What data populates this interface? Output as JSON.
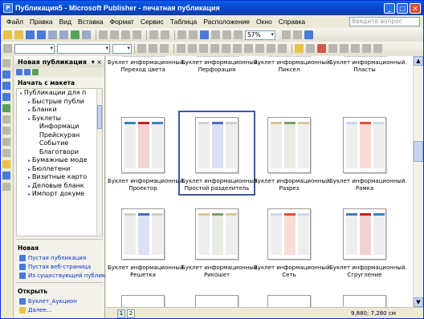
{
  "window": {
    "title": "Публикация5 - Microsoft Publisher - печатная публикация"
  },
  "menu": [
    "Файл",
    "Правка",
    "Вид",
    "Вставка",
    "Формат",
    "Сервис",
    "Таблица",
    "Расположение",
    "Окно",
    "Справка"
  ],
  "ask_placeholder": "Введите вопрос",
  "toolbar": {
    "zoom": "57%"
  },
  "taskpane": {
    "title": "Новая публикация",
    "start_label": "Начать с макета",
    "tree": [
      {
        "label": "Публикации для п",
        "level": 0
      },
      {
        "label": "Быстрые публи",
        "level": 1
      },
      {
        "label": "Бланки",
        "level": 1
      },
      {
        "label": "Буклеты",
        "level": 1
      },
      {
        "label": "Информаци",
        "level": 2
      },
      {
        "label": "Прейскуран",
        "level": 2
      },
      {
        "label": "Событие",
        "level": 2
      },
      {
        "label": "Благотвори",
        "level": 2
      },
      {
        "label": "Бумажные моде",
        "level": 1
      },
      {
        "label": "Бюллетени",
        "level": 1
      },
      {
        "label": "Визитные карто",
        "level": 1
      },
      {
        "label": "Деловые бланк",
        "level": 1
      },
      {
        "label": "Импорт докуме",
        "level": 1
      }
    ],
    "new_label": "Новая",
    "new_links": [
      "Пустая публикация",
      "Пустая веб-страница",
      "Из существующей публикации..."
    ],
    "open_label": "Открыть",
    "open_links": [
      "Буклет_Аукцион",
      "Далее..."
    ]
  },
  "gallery": {
    "rows": [
      [
        "Буклет информационный. Переход цвета",
        "Буклет информационный. Перфорация",
        "Буклет информационный. Пиксел",
        "Буклет информационный. Пласты"
      ],
      [
        "Буклет информационный. Проектор",
        "Буклет информационный. Простой разделитель",
        "Буклет информационный. Разрез",
        "Буклет информационный. Рамка"
      ],
      [
        "Буклет информационный. Решетка",
        "Буклет информационный. Рикошет",
        "Буклет информационный. Сеть",
        "Буклет информационный. Сгругление"
      ]
    ],
    "selected": "Буклет информационный. Простой разделитель"
  },
  "status": {
    "pages": [
      "1",
      "2"
    ],
    "coords": "9,880; 7,280 см"
  }
}
